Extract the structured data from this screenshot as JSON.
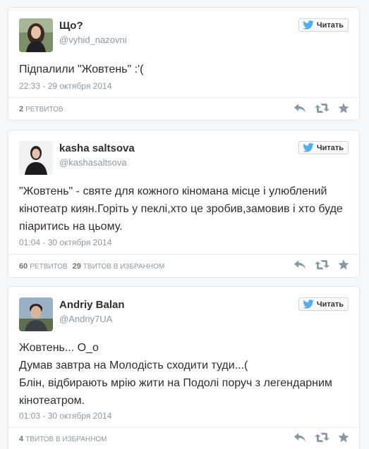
{
  "follow_label": "Читать",
  "tweets": [
    {
      "name": "Що?",
      "handle": "@vyhid_nazovni",
      "text": "Підпалили \"Жовтень\" :'(",
      "date": "22:33 - 29 октября 2014",
      "stat1_count": "2",
      "stat1_label": "ретвитов",
      "stat2_count": "",
      "stat2_label": ""
    },
    {
      "name": "kasha saltsova",
      "handle": "@kashasaltsova",
      "text": "\"Жовтень\" - святе для кожного кіномана місце і улюблений кінотеатр киян.Горіть у пеклі,хто це зробив,замовив і хто буде піаритись на цьому.",
      "date": "01:04 - 30 октября 2014",
      "stat1_count": "60",
      "stat1_label": "ретвитов",
      "stat2_count": "29",
      "stat2_label": "твитов в избранном"
    },
    {
      "name": "Andriy Balan",
      "handle": "@Andriy7UA",
      "text": "Жовтень... О_о\nДумав завтра на Молодість сходити туди...(\nБлін, відбирають мрію жити на Подолі поруч з легендарним кінотеатром.",
      "date": "01:03 - 30 октября 2014",
      "stat1_count": "4",
      "stat1_label": "твитов в избранном",
      "stat2_count": "",
      "stat2_label": ""
    }
  ],
  "colors": {
    "twitter_blue": "#55acee",
    "name_text": "#292f33",
    "meta_text": "#8899a6",
    "action_icon": "#8899a6"
  },
  "icons": [
    "twitter-bird-icon",
    "reply-icon",
    "retweet-icon",
    "favorite-star-icon"
  ]
}
